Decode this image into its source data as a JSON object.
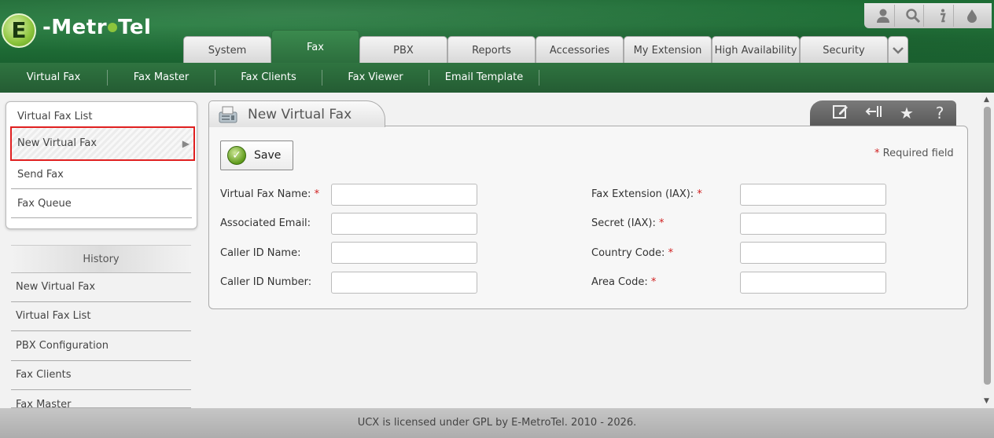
{
  "logo": {
    "letter": "E",
    "text_left": "-Metr",
    "text_right": "Tel"
  },
  "toolbar": {
    "icons": [
      "user-icon",
      "search-icon",
      "info-icon",
      "theme-drop-icon"
    ]
  },
  "tabs": [
    {
      "label": "System"
    },
    {
      "label": "Fax",
      "active": true
    },
    {
      "label": "PBX"
    },
    {
      "label": "Reports"
    },
    {
      "label": "Accessories"
    },
    {
      "label": "My Extension"
    },
    {
      "label": "High Availability"
    },
    {
      "label": "Security"
    }
  ],
  "subnav": [
    {
      "label": "Virtual Fax"
    },
    {
      "label": "Fax Master"
    },
    {
      "label": "Fax Clients"
    },
    {
      "label": "Fax Viewer"
    },
    {
      "label": "Email Template"
    }
  ],
  "sidebar": {
    "items": [
      {
        "label": "Virtual Fax List"
      },
      {
        "label": "New Virtual Fax",
        "selected": true
      },
      {
        "label": "Send Fax"
      },
      {
        "label": "Fax Queue"
      }
    ],
    "history_title": "History",
    "history": [
      {
        "label": "New Virtual Fax"
      },
      {
        "label": "Virtual Fax List"
      },
      {
        "label": "PBX Configuration"
      },
      {
        "label": "Fax Clients"
      },
      {
        "label": "Fax Master"
      }
    ]
  },
  "panel": {
    "title": "New Virtual Fax",
    "save_label": "Save",
    "required_note": "Required field",
    "left_fields": [
      {
        "label": "Virtual Fax Name:",
        "required": true,
        "value": ""
      },
      {
        "label": "Associated Email:",
        "required": false,
        "value": ""
      },
      {
        "label": "Caller ID Name:",
        "required": false,
        "value": ""
      },
      {
        "label": "Caller ID Number:",
        "required": false,
        "value": ""
      }
    ],
    "right_fields": [
      {
        "label": "Fax Extension (IAX):",
        "required": true,
        "value": ""
      },
      {
        "label": "Secret (IAX):",
        "required": true,
        "value": ""
      },
      {
        "label": "Country Code:",
        "required": true,
        "value": ""
      },
      {
        "label": "Area Code:",
        "required": true,
        "value": ""
      }
    ]
  },
  "footer": {
    "text": "UCX is licensed under GPL by E-MetroTel. 2010 - 2026."
  },
  "colors": {
    "header_green": "#247a3d",
    "subnav_green": "#2f7440",
    "required_red": "#d02020",
    "selection_outline": "#e02020"
  }
}
